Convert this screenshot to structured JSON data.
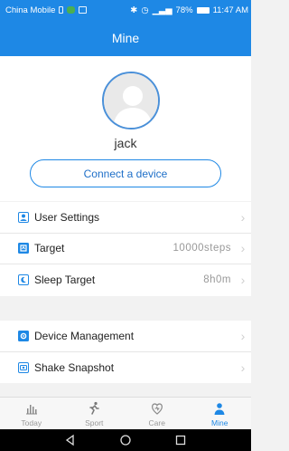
{
  "status_bar": {
    "carrier": "China Mobile",
    "battery": "78%",
    "time": "11:47 AM"
  },
  "header": {
    "title": "Mine"
  },
  "profile": {
    "username": "jack",
    "connect_label": "Connect a device"
  },
  "settings_group": {
    "items": [
      {
        "label": "User Settings",
        "value": "",
        "icon": "user-settings-icon"
      },
      {
        "label": "Target",
        "value": "10000steps",
        "icon": "target-icon"
      },
      {
        "label": "Sleep Target",
        "value": "8h0m",
        "icon": "sleep-target-icon"
      }
    ]
  },
  "device_group": {
    "items": [
      {
        "label": "Device Management",
        "value": "",
        "icon": "device-management-icon"
      },
      {
        "label": "Shake Snapshot",
        "value": "",
        "icon": "shake-snapshot-icon"
      }
    ]
  },
  "tab_bar": {
    "tabs": [
      {
        "label": "Today",
        "icon": "bar-chart-icon",
        "active": false
      },
      {
        "label": "Sport",
        "icon": "runner-icon",
        "active": false
      },
      {
        "label": "Care",
        "icon": "care-icon",
        "active": false
      },
      {
        "label": "Mine",
        "icon": "person-icon",
        "active": true
      }
    ]
  },
  "colors": {
    "primary": "#1e88e5",
    "background": "#f2f2f2",
    "inactive_tab": "#999999"
  }
}
